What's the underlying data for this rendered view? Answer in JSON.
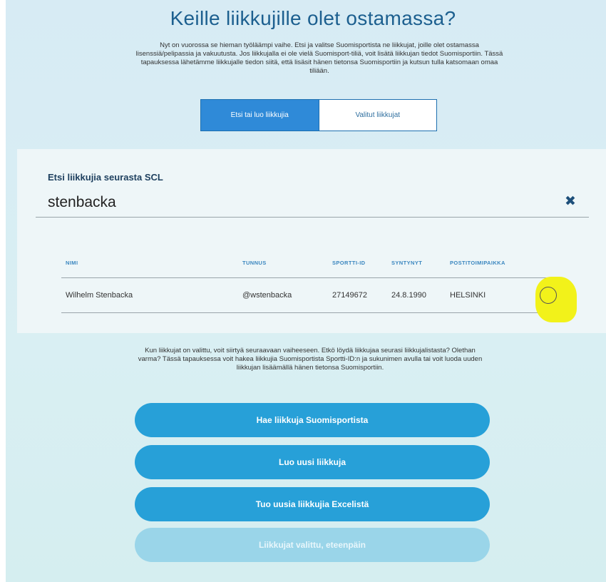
{
  "header": {
    "title": "Keille liikkujille olet ostamassa?",
    "intro": "Nyt on vuorossa se hieman työläämpi vaihe. Etsi ja valitse Suomisportista ne liikkujat, joille olet ostamassa lisenssiä/pelipassia ja vakuutusta. Jos liikkujalla ei ole vielä Suomisport-tiliä, voit lisätä liikkujan tiedot Suomisportiin. Tässä tapauksessa lähetämme liikkujalle tiedon siitä, että lisäsit hänen tietonsa Suomisportiin ja kutsun tulla katsomaan omaa tiliään."
  },
  "tabs": {
    "search": "Etsi tai luo liikkujia",
    "selected": "Valitut liikkujat"
  },
  "search": {
    "label": "Etsi liikkujia seurasta SCL",
    "value": "stenbacka",
    "clear_icon": "close-icon"
  },
  "table": {
    "headers": [
      "NIMI",
      "TUNNUS",
      "SPORTTI-ID",
      "SYNTYNYT",
      "POSTITOIMIPAIKKA"
    ],
    "rows": [
      {
        "name": "Wilhelm Stenbacka",
        "username": "@wstenbacka",
        "sportti_id": "27149672",
        "born": "24.8.1990",
        "city": "HELSINKI"
      }
    ]
  },
  "help_text": "Kun liikkujat on valittu, voit siirtyä seuraavaan vaiheeseen. Etkö löydä liikkujaa seurasi liikkujalistasta? Olethan varma? Tässä tapauksessa voit hakea liikkujia Suomisportista Sportti-ID:n ja sukunimen avulla tai voit luoda uuden liikkujan lisäämällä hänen tietonsa Suomisportiin.",
  "buttons": {
    "fetch": "Hae liikkuja Suomisportista",
    "create": "Luo uusi liikkuja",
    "import": "Tuo uusia liikkujia Excelistä",
    "continue": "Liikkujat valittu, eteenpäin"
  },
  "colors": {
    "accent": "#27a0d8",
    "title": "#1c5f8f",
    "highlight": "#f2f21a"
  }
}
